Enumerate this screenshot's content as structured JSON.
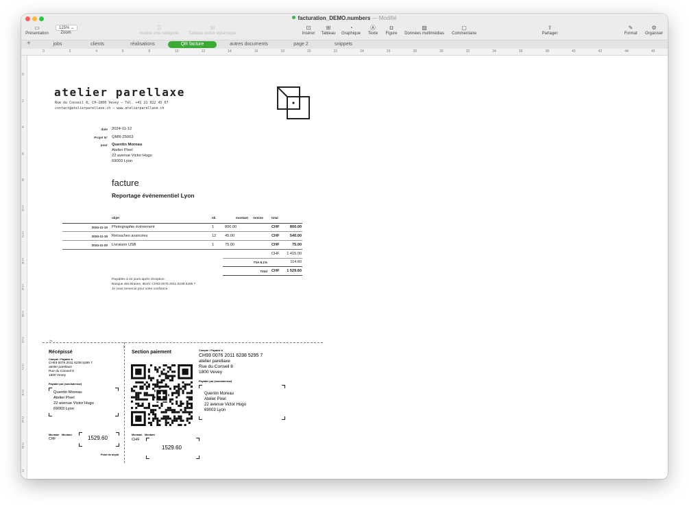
{
  "window": {
    "filename": "facturation_DEMO.numbers",
    "separator": "—",
    "status": "Modifié"
  },
  "toolbar": {
    "presentation": "Présentation",
    "zoom_label": "Zoom",
    "zoom_value": "125% ⌄",
    "insert_category": "Insérer une catégorie",
    "pivot_table": "Tableau croisé dynamique",
    "insert": "Insérer",
    "table": "Tableau",
    "chart": "Graphique",
    "text": "Texte",
    "shape": "Figure",
    "media": "Données multimédias",
    "comment": "Commentaire",
    "share": "Partager",
    "format": "Format",
    "organize": "Organiser"
  },
  "tabs": [
    "jobs",
    "clients",
    "réalisations",
    "QR facture",
    "autres documents",
    "page 2",
    "snippets"
  ],
  "active_tab": "QR facture",
  "ruler_h": [
    "0",
    "2",
    "4",
    "6",
    "8",
    "10",
    "12",
    "14",
    "16",
    "18",
    "20",
    "22",
    "24",
    "26",
    "28",
    "30",
    "32",
    "34",
    "36",
    "38",
    "40",
    "42",
    "44",
    "46"
  ],
  "ruler_v": [
    "0",
    "2",
    "4",
    "6",
    "8",
    "1\n0",
    "1\n2",
    "1\n4",
    "1\n6",
    "1\n8",
    "2\n0",
    "2\n2",
    "2\n4",
    "2\n6",
    "2\n8",
    "3"
  ],
  "invoice": {
    "brand": "atelier parellaxe",
    "address_line": "Rue du Conseil 8, CH–1800 Vevey – Tél. +41 21 922 45 67",
    "contact_line": "contact@atelierparellaxe.ch – www.atelierparellaxe.ch",
    "date_label": "date",
    "date_value": "2024-11-12",
    "project_label": "Projet N°",
    "project_value": "QMR-25003",
    "for_label": "pour",
    "client": {
      "name": "Quentin Moreau",
      "company": "Atelier Pixel",
      "street": "22 avenue Victor Hugo",
      "city": "69003 Lyon"
    },
    "doc_type": "facture",
    "subject": "Reportage événementiel Lyon",
    "headers": {
      "object": "objet",
      "qty": "nb",
      "amount": "montant",
      "discount": "remise",
      "total": "total"
    },
    "rows": [
      {
        "date": "2024-11-10",
        "item": "Photographie événement",
        "qty": "1",
        "amount": "800.00",
        "currency": "CHF",
        "total": "800.00"
      },
      {
        "date": "2024-11-15",
        "item": "Retouches avancées",
        "qty": "12",
        "amount": "45.00",
        "currency": "CHF",
        "total": "540.00"
      },
      {
        "date": "2024-11-20",
        "item": "Livraison USB",
        "qty": "1",
        "amount": "75.00",
        "currency": "CHF",
        "total": "75.00"
      }
    ],
    "subtotal_currency": "CHF",
    "subtotal": "1 415.00",
    "vat_label": "TVA 8.1%",
    "vat": "114.60",
    "total_label": "Total",
    "total_currency": "CHF",
    "total": "1 529.60",
    "notes": [
      "Payables à 10 jours après réception.",
      "Banque des Braves, IBAN: CH93 0076 2011 6238 5295 7",
      "Je vous remercie pour votre confiance."
    ]
  },
  "qr": {
    "receipt_title": "Récépissé",
    "account_label": "Compte / Payable à",
    "iban": "CH93 0076 2011 6238 5295 7",
    "creditor": "atelier parellaxe",
    "creditor_street": "Rue du Conseil 8",
    "creditor_city": "1800 Vevey",
    "payable_by_label": "Payable par (nom/adresse)",
    "debtor": {
      "name": "Quentin Moreau",
      "company": "Atelier Pixel",
      "street": "22 avenue Victor Hugo",
      "city": "69003 Lyon"
    },
    "currency_label": "Monnaie",
    "amount_label": "Montant",
    "currency": "CHF",
    "amount": "1529.60",
    "deposit_point": "Point de dépôt",
    "payment_title": "Section paiement",
    "scissors": "✂"
  },
  "colors": {
    "accent": "#3aaa35",
    "window_bg": "#ececec"
  }
}
